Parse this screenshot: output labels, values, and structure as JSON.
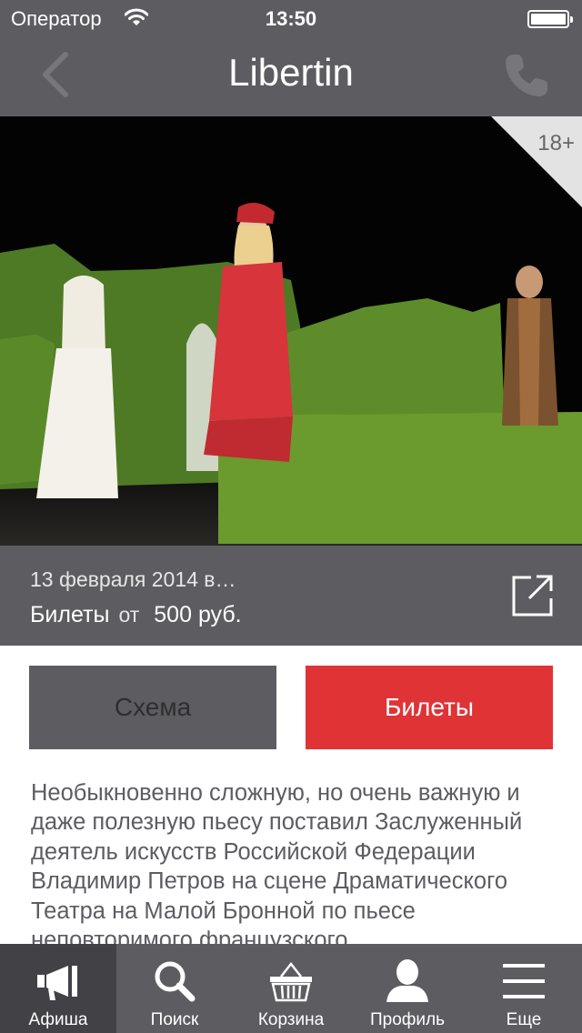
{
  "status_bar": {
    "carrier": "Оператор",
    "time": "13:50"
  },
  "nav": {
    "title": "Libertin"
  },
  "event": {
    "age_rating": "18+",
    "date": "13 февраля 2014 в…",
    "tickets_label": "Билеты",
    "price_from": "от",
    "price": "500 руб."
  },
  "buttons": {
    "scheme": "Схема",
    "tickets": "Билеты"
  },
  "description": "Необыкновенно сложную, но очень важную и даже полезную пьесу поставил Заслуженный деятель искусств Российской Федерации Владимир Петров на сцене Драматического Театра на Малой Бронной по пьесе неповторимого французского",
  "tabs": [
    {
      "label": "Афиша",
      "icon": "megaphone-icon",
      "active": true
    },
    {
      "label": "Поиск",
      "icon": "search-icon"
    },
    {
      "label": "Корзина",
      "icon": "basket-icon"
    },
    {
      "label": "Профиль",
      "icon": "profile-icon"
    },
    {
      "label": "Еще",
      "icon": "menu-icon"
    }
  ],
  "colors": {
    "bar": "#5d5c61",
    "accent": "#e03336",
    "active_tab": "#424146"
  }
}
